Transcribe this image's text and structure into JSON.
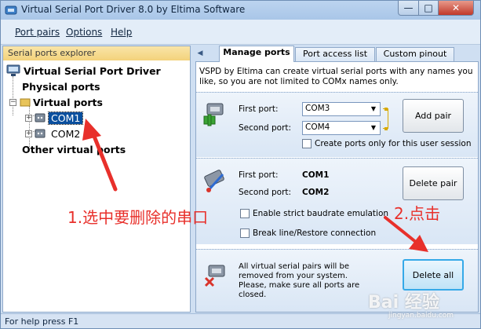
{
  "window": {
    "title": "Virtual Serial Port Driver 8.0 by Eltima Software"
  },
  "menu": {
    "items": [
      {
        "label": "Port pairs"
      },
      {
        "label": "Options"
      },
      {
        "label": "Help"
      }
    ]
  },
  "explorer": {
    "header": "Serial ports explorer",
    "root": "Virtual Serial Port Driver",
    "physical": "Physical ports",
    "virtual": "Virtual ports",
    "com1": "COM1",
    "com2": "COM2",
    "other": "Other virtual ports"
  },
  "tabs": [
    {
      "label": "Manage ports",
      "active": true
    },
    {
      "label": "Port access list",
      "active": false
    },
    {
      "label": "Custom pinout",
      "active": false
    }
  ],
  "manage": {
    "description": "VSPD by Eltima can create virtual serial ports with any names you like, so you are not limited to COMx names only.",
    "add": {
      "first_label": "First port:",
      "first_value": "COM3",
      "second_label": "Second port:",
      "second_value": "COM4",
      "button": "Add pair",
      "checkbox": "Create ports only for this user session"
    },
    "delete": {
      "first_label": "First port:",
      "first_value": "COM1",
      "second_label": "Second port:",
      "second_value": "COM2",
      "button": "Delete pair",
      "strict": "Enable strict baudrate emulation",
      "break": "Break line/Restore connection"
    },
    "delete_all": {
      "text": "All virtual serial pairs will be removed from your system. Please, make sure all ports are closed.",
      "button": "Delete all"
    }
  },
  "status": {
    "text": "For help press F1"
  },
  "annotations": {
    "step1": "1.选中要删除的串口",
    "step2": "2.点击"
  },
  "watermark": {
    "text": "Bai 经验",
    "sub": "jingyan.baidu.com"
  },
  "colors": {
    "selection": "#0a4f9e",
    "annotation": "#e8302b",
    "header": "#f3d27b",
    "focus": "#35a9e8"
  }
}
